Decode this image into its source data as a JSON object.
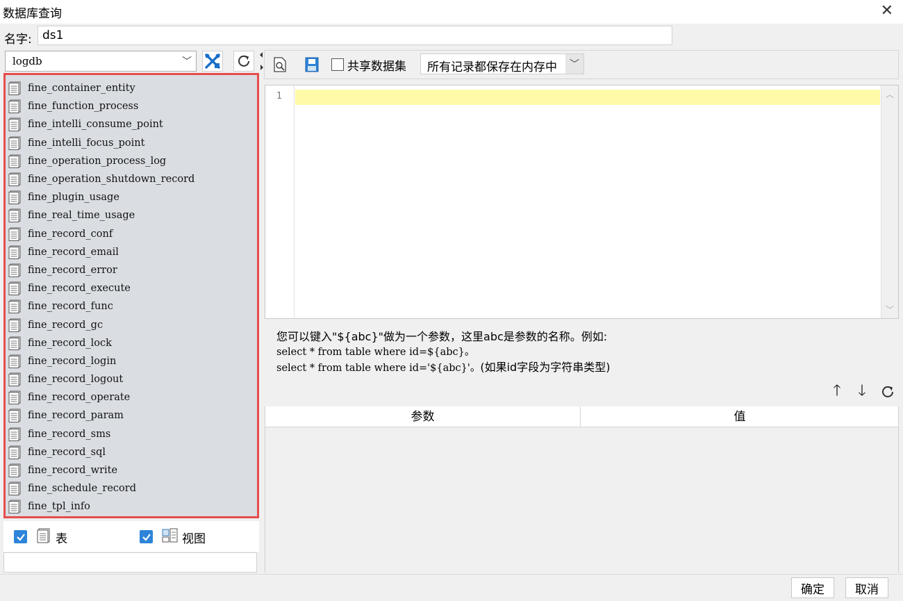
{
  "window": {
    "title": "数据库查询",
    "close_icon": "close-icon"
  },
  "name_field": {
    "label": "名字:",
    "value": "ds1"
  },
  "left": {
    "database": "logdb",
    "tables": [
      "fine_container_entity",
      "fine_function_process",
      "fine_intelli_consume_point",
      "fine_intelli_focus_point",
      "fine_operation_process_log",
      "fine_operation_shutdown_record",
      "fine_plugin_usage",
      "fine_real_time_usage",
      "fine_record_conf",
      "fine_record_email",
      "fine_record_error",
      "fine_record_execute",
      "fine_record_func",
      "fine_record_gc",
      "fine_record_lock",
      "fine_record_login",
      "fine_record_logout",
      "fine_record_operate",
      "fine_record_param",
      "fine_record_sms",
      "fine_record_sql",
      "fine_record_write",
      "fine_schedule_record",
      "fine_tpl_info"
    ],
    "show_tables_label": "表",
    "show_views_label": "视图"
  },
  "right": {
    "share_label": "共享数据集",
    "memory_option": "所有记录都保存在内存中",
    "line_number": "1",
    "hint_line1": "您可以键入\"${abc}\"做为一个参数，这里abc是参数的名称。例如:",
    "hint_line2": "select * from table where id=${abc}。",
    "hint_line3_code": "select * from table where id='${abc}'。",
    "hint_line3_note": "(如果id字段为字符串类型)",
    "param_header": "参数",
    "value_header": "值"
  },
  "buttons": {
    "ok": "确定",
    "cancel": "取消"
  },
  "colors": {
    "highlight_border": "#e74c4c",
    "accent": "#2d84d8",
    "current_line": "#fffaa8"
  }
}
